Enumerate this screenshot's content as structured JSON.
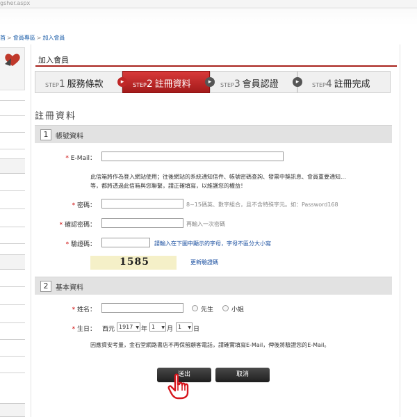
{
  "browser": {
    "url_fragment": "gsher.aspx"
  },
  "breadcrumb": {
    "home": "首",
    "member": "會員專區",
    "join": "加入會員"
  },
  "page": {
    "title": "加入會員",
    "section_title": "註冊資料"
  },
  "steps": [
    {
      "prefix": "STEP",
      "num": "1",
      "label": "服務條款"
    },
    {
      "prefix": "STEP",
      "num": "2",
      "label": "註冊資料"
    },
    {
      "prefix": "STEP",
      "num": "3",
      "label": "會員認證"
    },
    {
      "prefix": "STEP",
      "num": "4",
      "label": "註冊完成"
    }
  ],
  "account": {
    "num": "1",
    "title": "帳號資料",
    "email_label": "E-Mail：",
    "email_note_1": "此信箱將作為登入網站使用；往後網站的系統通知信件、帳號密碼查詢、發票中獎訊息、會員重要通知...",
    "email_note_2": "等，都將透過此信箱與您聯繫，請正確填寫，以維護您的權益！",
    "password_label": "密碼：",
    "password_hint": "8~15碼英、數字組合，且不含特殊字元。如：Password168",
    "confirm_label": "確認密碼：",
    "confirm_hint": "再輸入一次密碼",
    "captcha_label": "驗證碼：",
    "captcha_hint": "請輸入在下圖中顯示的字母，字母不區分大小寫",
    "captcha_code": "1585",
    "captcha_refresh": "更新驗證碼"
  },
  "basic": {
    "num": "2",
    "title": "基本資料",
    "name_label": "姓名：",
    "mr": "先生",
    "ms": "小姐",
    "birthday_label": "生日：",
    "era": "西元",
    "year": "1917",
    "year_unit": "年",
    "month": "1",
    "month_unit": "月",
    "day": "1",
    "day_unit": "日",
    "privacy_note": "因應資安考量，金石堂網路書店不再保留顧客電話，請確實填寫E-Mail，俾後將驗證您的E-Mail。"
  },
  "buttons": {
    "submit": "送出",
    "cancel": "取消"
  },
  "required_mark": "*",
  "colors": {
    "accent": "#a8211b",
    "link": "#1a4fa0"
  }
}
